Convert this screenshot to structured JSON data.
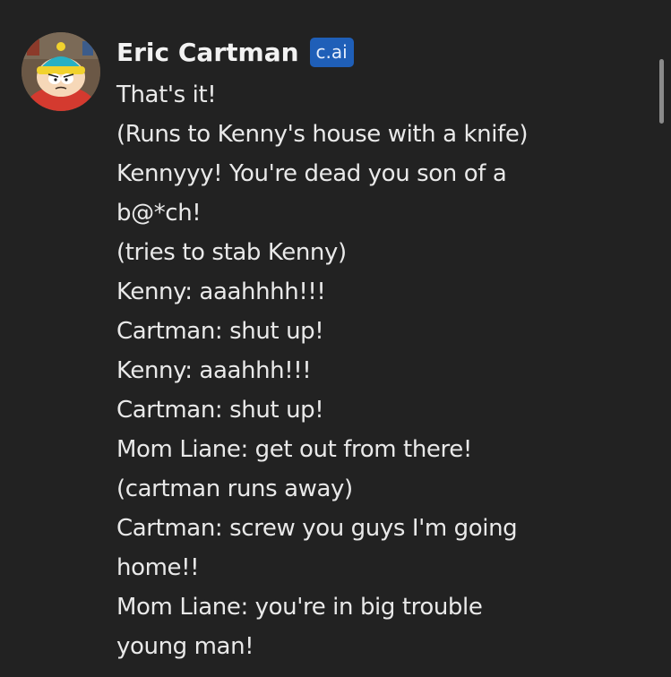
{
  "message": {
    "author": "Eric Cartman",
    "badge": "c.ai",
    "avatar": "cartman-avatar",
    "lines": [
      "That's it!",
      "(Runs to Kenny's house with a knife)",
      "Kennyyy! You're dead you son of a",
      "b@*ch!",
      "(tries to stab Kenny)",
      "Kenny: aaahhhh!!!",
      "Cartman: shut up!",
      "Kenny: aaahhh!!!",
      "Cartman: shut up!",
      "Mom Liane: get out from there!",
      "(cartman runs away)",
      "Cartman: screw you guys I'm going",
      "home!!",
      "Mom Liane: you're in big trouble",
      "young man!"
    ]
  },
  "colors": {
    "background": "#222222",
    "text": "#e9e9e9",
    "badge": "#1f5fb8"
  }
}
